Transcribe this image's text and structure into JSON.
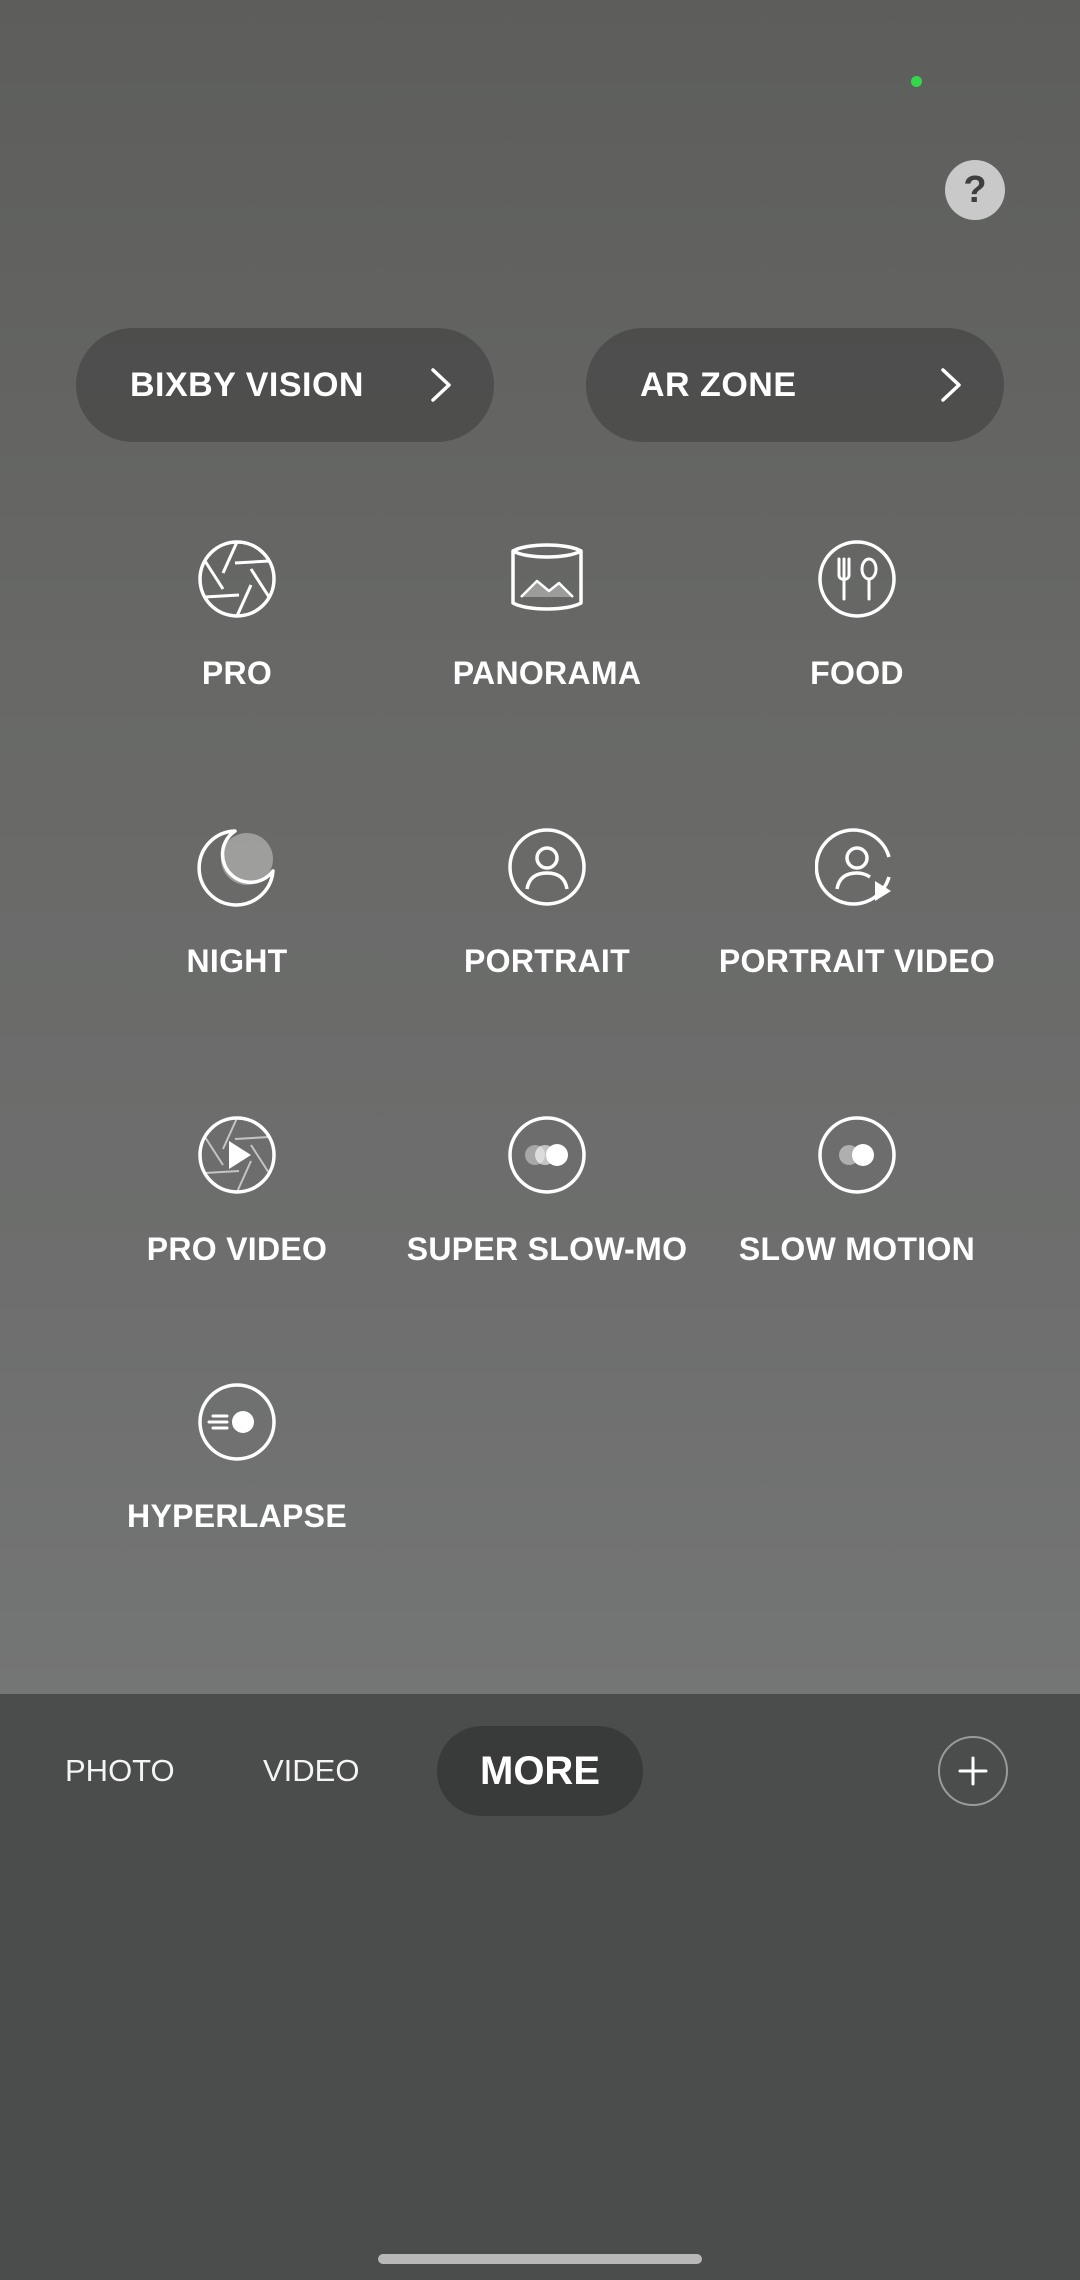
{
  "quick_access": {
    "bixby_vision": "BIXBY VISION",
    "ar_zone": "AR ZONE"
  },
  "modes": [
    {
      "label": "PRO",
      "icon": "aperture-icon"
    },
    {
      "label": "PANORAMA",
      "icon": "panorama-icon"
    },
    {
      "label": "FOOD",
      "icon": "food-icon"
    },
    {
      "label": "NIGHT",
      "icon": "moon-icon"
    },
    {
      "label": "PORTRAIT",
      "icon": "portrait-icon"
    },
    {
      "label": "PORTRAIT VIDEO",
      "icon": "portrait-video-icon"
    },
    {
      "label": "PRO VIDEO",
      "icon": "pro-video-icon"
    },
    {
      "label": "SUPER SLOW-MO",
      "icon": "super-slow-mo-icon"
    },
    {
      "label": "SLOW MOTION",
      "icon": "slow-motion-icon"
    },
    {
      "label": "HYPERLAPSE",
      "icon": "hyperlapse-icon"
    }
  ],
  "mode_bar": {
    "tabs": [
      "PHOTO",
      "VIDEO"
    ],
    "active": "MORE"
  },
  "help_symbol": "?",
  "colors": {
    "privacy_indicator": "#34d74a",
    "pill_background": "#3c3c3c",
    "active_tab_background": "#393a3a"
  }
}
